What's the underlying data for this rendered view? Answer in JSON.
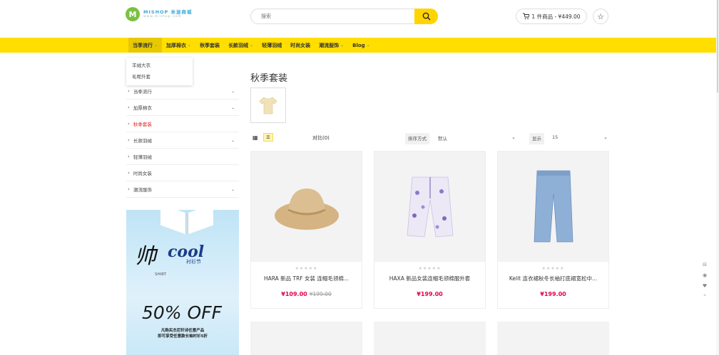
{
  "header": {
    "logo_mark": "M",
    "logo_name": "MISHOP 米迷商城",
    "logo_sub": "www.mishop.com",
    "search_placeholder": "搜索",
    "cart_label": "1 件商品 - ¥449.00"
  },
  "nav": {
    "items": [
      {
        "label": "当季流行",
        "has_caret": true,
        "active": true
      },
      {
        "label": "加厚棉衣",
        "has_caret": true
      },
      {
        "label": "秋季套装",
        "has_caret": false
      },
      {
        "label": "长款羽绒",
        "has_caret": true
      },
      {
        "label": "轻薄羽绒",
        "has_caret": false
      },
      {
        "label": "时尚女装",
        "has_caret": false
      },
      {
        "label": "潮流服饰",
        "has_caret": true
      },
      {
        "label": "Blog",
        "has_caret": true
      }
    ],
    "dropdown": [
      "羊绒大衣",
      "毛呢外套"
    ]
  },
  "sidebar": {
    "items": [
      {
        "label": "当季流行",
        "expand": "⌄"
      },
      {
        "label": "加厚棉衣",
        "expand": "⌄"
      },
      {
        "label": "秋季套装",
        "expand": "",
        "active": true
      },
      {
        "label": "长款羽绒",
        "expand": "⌄"
      },
      {
        "label": "轻薄羽绒",
        "expand": ""
      },
      {
        "label": "时尚女装",
        "expand": ""
      },
      {
        "label": "潮流服饰",
        "expand": "⌄"
      }
    ]
  },
  "banner": {
    "shuai": "帅",
    "cool": "cool",
    "sub": "衬衫节",
    "shirt_word": "SHIRT",
    "percent": "50% OFF",
    "note_line1": "凡购买杰尼轩诗任意产品",
    "note_line2": "即可享受任意款长袖衬衫5折"
  },
  "main": {
    "title": "秋季套装",
    "compare": "对比(0)",
    "sort_label": "排序方式",
    "sort_value": "默认",
    "show_label": "显示",
    "show_value": "15"
  },
  "products": [
    {
      "name": "HARA 新品 TRF 女装 连帽毛领棉...",
      "price": "¥109.00",
      "old_price": "¥199.00",
      "stars": "★★★★★",
      "image": "straw-hat"
    },
    {
      "name": "HAXA 新品女装连帽毛领棉服外套",
      "price": "¥199.00",
      "old_price": "",
      "stars": "★★★★★",
      "image": "floral-pants"
    },
    {
      "name": "Kelit 连衣裙秋冬长袖打底裙宽松中...",
      "price": "¥199.00",
      "old_price": "",
      "stars": "★★★★★",
      "image": "denim-jeans"
    }
  ],
  "colors": {
    "accent": "#ffde00",
    "price": "#e4004f",
    "active": "#e21a1a"
  }
}
